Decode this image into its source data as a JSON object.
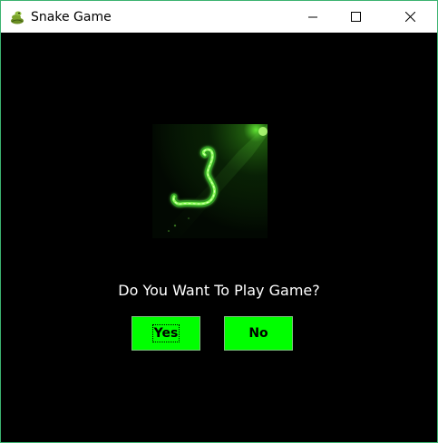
{
  "window": {
    "title": "Snake Game",
    "icon": "snake-icon",
    "controls": {
      "minimize": "minimize-icon",
      "maximize": "maximize-icon",
      "close": "close-icon"
    }
  },
  "dialog": {
    "image": "glowing-green-snake",
    "question": "Do You Want To Play Game?",
    "yes_label": "Yes",
    "no_label": "No"
  },
  "colors": {
    "background": "#000000",
    "button": "#00ff00",
    "text": "#ffffff",
    "window_border": "#3cb371"
  }
}
